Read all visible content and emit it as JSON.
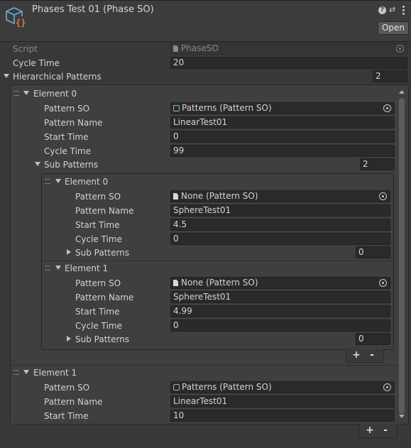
{
  "header": {
    "title": "Phases Test 01 (Phase SO)",
    "open_label": "Open",
    "icons": [
      "scriptable-object-icon",
      "help-icon",
      "preset-icon",
      "kebab-menu-icon"
    ]
  },
  "props": {
    "script_label": "Script",
    "script_value": "PhaseSO",
    "cycle_time_label": "Cycle Time",
    "cycle_time_value": "20",
    "hier_label": "Hierarchical Patterns",
    "hier_count": "2"
  },
  "labels": {
    "pattern_so": "Pattern SO",
    "pattern_name": "Pattern Name",
    "start_time": "Start Time",
    "cycle_time": "Cycle Time",
    "sub_patterns": "Sub Patterns"
  },
  "elements": [
    {
      "title": "Element 0",
      "pattern_so": "Patterns (Pattern SO)",
      "pattern_name": "LinearTest01",
      "start_time": "0",
      "cycle_time": "99",
      "sub_count": "2",
      "subs": [
        {
          "title": "Element 0",
          "pattern_so": "None (Pattern SO)",
          "pattern_name": "SphereTest01",
          "start_time": "4.5",
          "cycle_time": "0",
          "sub_count": "0"
        },
        {
          "title": "Element 1",
          "pattern_so": "None (Pattern SO)",
          "pattern_name": "SphereTest01",
          "start_time": "4.99",
          "cycle_time": "0",
          "sub_count": "0"
        }
      ]
    },
    {
      "title": "Element 1",
      "pattern_so": "Patterns (Pattern SO)",
      "pattern_name": "LinearTest01",
      "start_time": "10"
    }
  ],
  "buttons": {
    "add": "+",
    "remove": "-"
  }
}
